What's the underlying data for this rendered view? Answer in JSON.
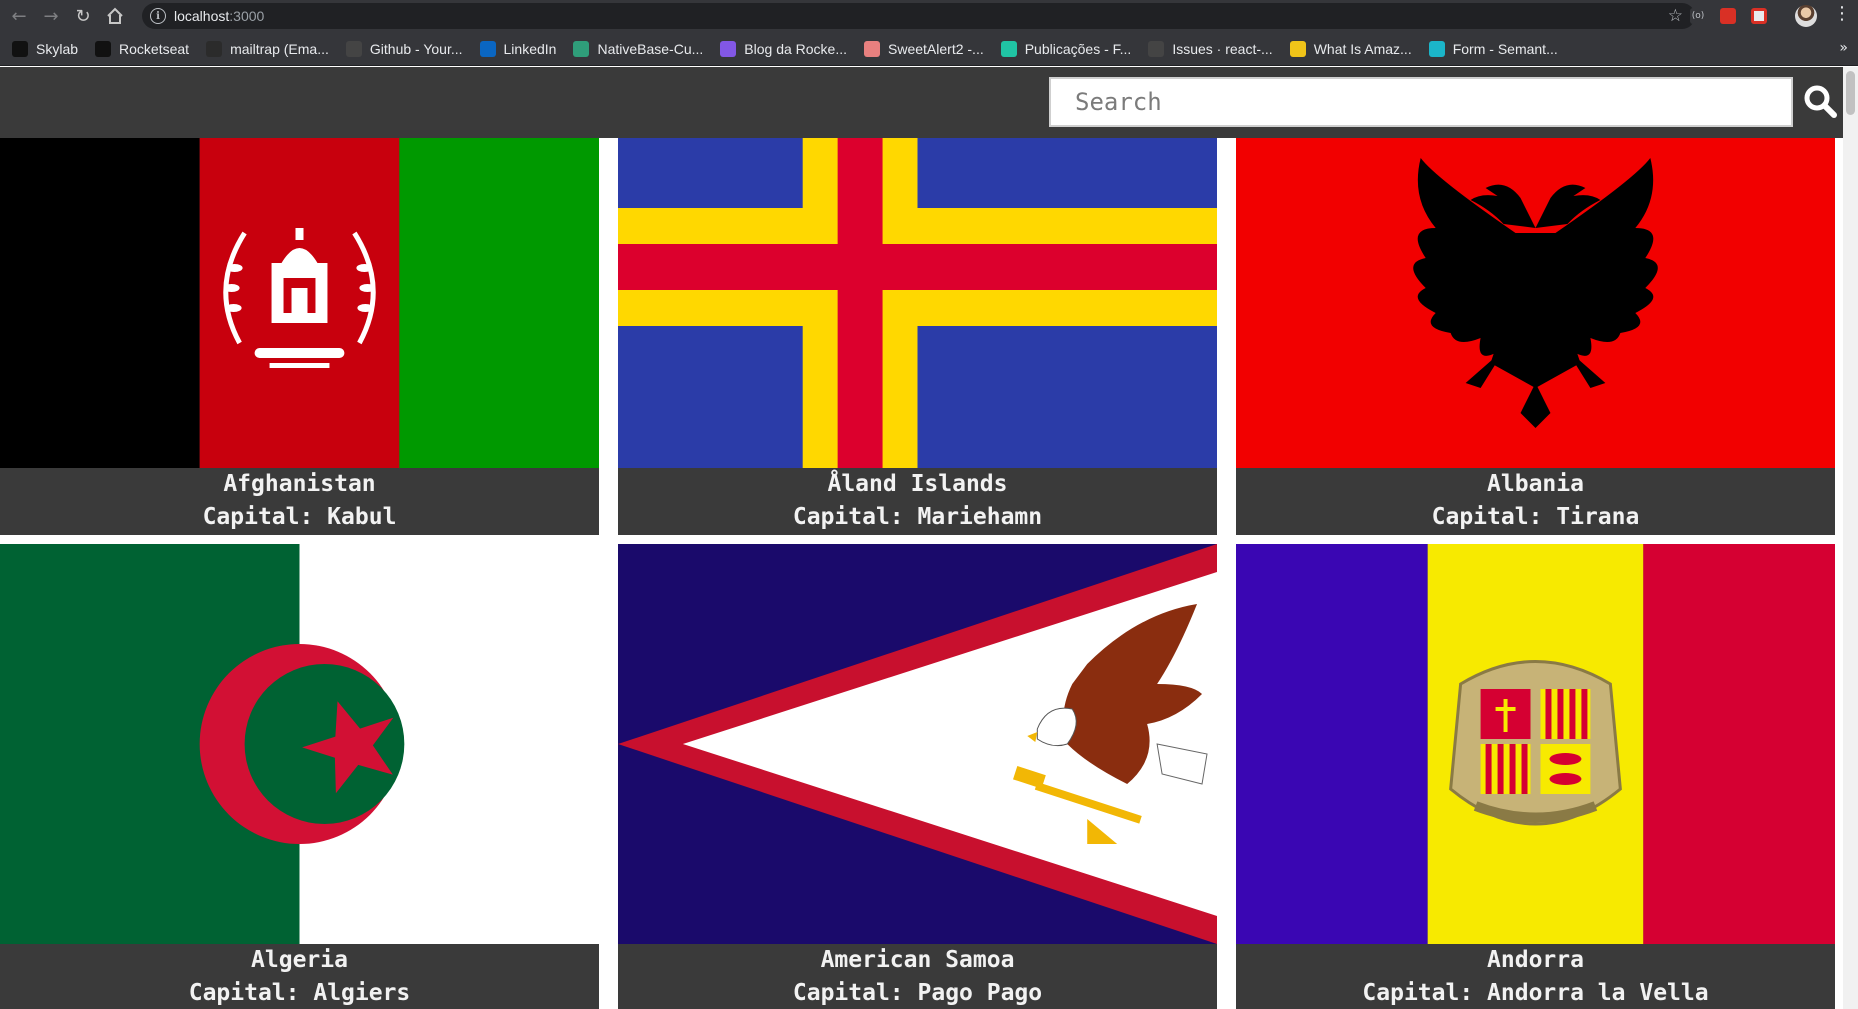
{
  "browser": {
    "url_host": "localhost",
    "url_port": ":3000",
    "bookmarks": [
      {
        "label": "Skylab",
        "icon": "skylab-icon",
        "color": "#111111"
      },
      {
        "label": "Rocketseat",
        "icon": "rocketseat-icon",
        "color": "#111111"
      },
      {
        "label": "mailtrap (Ema...",
        "icon": "mailtrap-icon",
        "color": "#2b2b2b"
      },
      {
        "label": "Github - Your...",
        "icon": "github-icon",
        "color": "#444444"
      },
      {
        "label": "LinkedIn",
        "icon": "linkedin-icon",
        "color": "#0a66c2"
      },
      {
        "label": "NativeBase-Cu...",
        "icon": "nativebase-icon",
        "color": "#2f9e7a"
      },
      {
        "label": "Blog da Rocke...",
        "icon": "rocketseat-blog-icon",
        "color": "#8257e5"
      },
      {
        "label": "SweetAlert2 -...",
        "icon": "sweetalert-icon",
        "color": "#e8807f"
      },
      {
        "label": "Publicações - F...",
        "icon": "diamond-icon",
        "color": "#20c4a4"
      },
      {
        "label": "Issues · react-...",
        "icon": "github-icon",
        "color": "#444444"
      },
      {
        "label": "What Is Amaz...",
        "icon": "aws-icon",
        "color": "#f0c419"
      },
      {
        "label": "Form - Semant...",
        "icon": "react-icon",
        "color": "#1bb5c9"
      }
    ],
    "more_label": "»"
  },
  "header": {
    "search_placeholder": "Search",
    "search_value": ""
  },
  "countries": [
    {
      "name": "Afghanistan",
      "capital_label": "Capital: Kabul",
      "flag": "afghanistan-flag"
    },
    {
      "name": "Åland Islands",
      "capital_label": "Capital: Mariehamn",
      "flag": "aland-islands-flag"
    },
    {
      "name": "Albania",
      "capital_label": "Capital: Tirana",
      "flag": "albania-flag"
    },
    {
      "name": "Algeria",
      "capital_label": "Capital: Algiers",
      "flag": "algeria-flag"
    },
    {
      "name": "American Samoa",
      "capital_label": "Capital: Pago Pago",
      "flag": "american-samoa-flag"
    },
    {
      "name": "Andorra",
      "capital_label": "Capital: Andorra la Vella",
      "flag": "andorra-flag"
    }
  ],
  "colors": {
    "header_bg": "#3a3a3a",
    "caption_bg": "#3a3a3a",
    "caption_text": "#f2f2f2"
  }
}
